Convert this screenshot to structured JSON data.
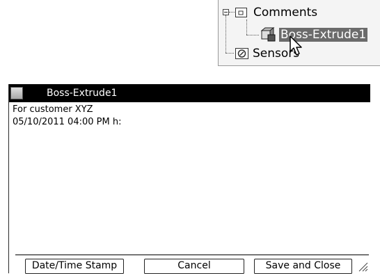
{
  "tree": {
    "items": [
      {
        "label": "Comments",
        "icon": "folder-icon"
      },
      {
        "label": "Boss-Extrude1",
        "icon": "boss-extrude-icon",
        "selected": true
      },
      {
        "label": "Sensors",
        "icon": "sensor-icon"
      }
    ]
  },
  "note": {
    "title": "Boss-Extrude1",
    "lines": [
      "For customer XYZ",
      "05/10/2011 04:00 PM  h:"
    ],
    "buttons": {
      "datetime": "Date/Time Stamp",
      "cancel": "Cancel",
      "save_close": "Save and Close"
    }
  },
  "colors": {
    "titlebar": "#000000",
    "selection": "#6b6b6b",
    "tree_bg": "#f4f4f4"
  }
}
